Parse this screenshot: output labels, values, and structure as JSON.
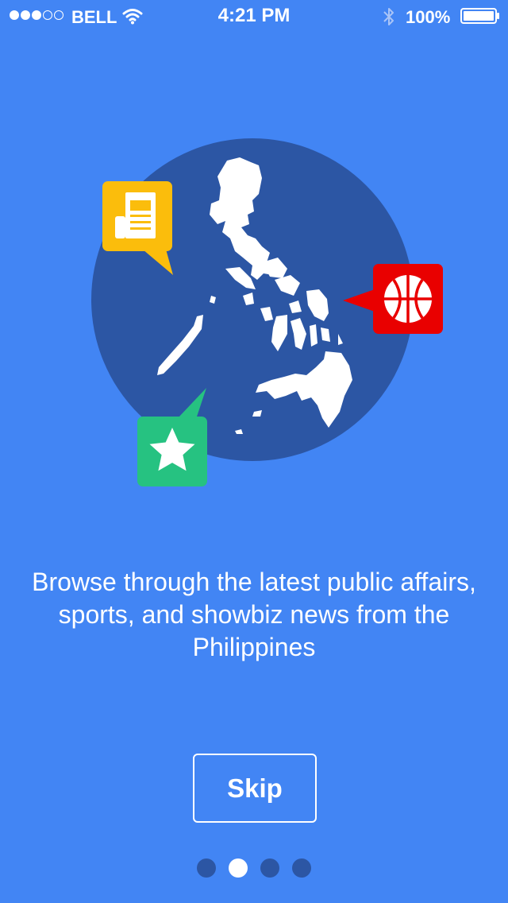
{
  "status_bar": {
    "signal_strength": 3,
    "signal_max": 5,
    "carrier": "BELL",
    "time": "4:21 PM",
    "battery_percent": "100%",
    "icons": [
      "wifi-icon",
      "bluetooth-icon",
      "battery-icon"
    ]
  },
  "illustration": {
    "icons": [
      "philippines-map-icon",
      "newspaper-icon",
      "basketball-icon",
      "star-icon"
    ],
    "colors": {
      "circle": "#2c56a4",
      "newspaper_bubble": "#fbbd0c",
      "basketball_bubble": "#e90000",
      "star_bubble": "#26c281"
    }
  },
  "onboarding": {
    "tagline": "Browse through the latest public affairs, sports, and showbiz news from the Philippines",
    "skip_label": "Skip"
  },
  "pagination": {
    "total_pages": 4,
    "current_page": 2
  },
  "colors": {
    "background": "#4285f4",
    "inactive_dot": "#2c56a4",
    "active_dot": "#ffffff"
  }
}
